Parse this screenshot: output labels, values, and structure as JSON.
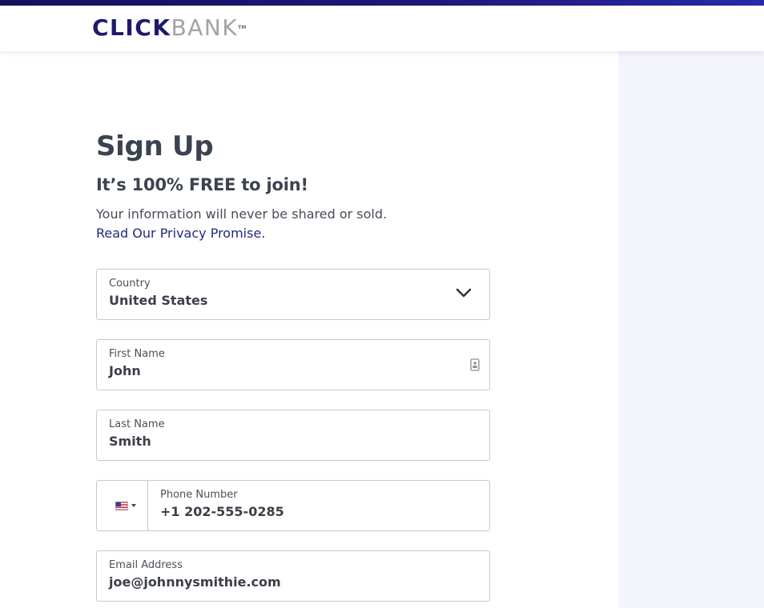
{
  "header": {
    "logo_click": "CLICK",
    "logo_bank": "BANK",
    "logo_tm": "TM"
  },
  "signup": {
    "title": "Sign Up",
    "subtitle": "It’s 100% FREE to join!",
    "info": "Your information will never be shared or sold.",
    "privacy_link": "Read Our Privacy Promise."
  },
  "form": {
    "country": {
      "label": "Country",
      "value": "United States"
    },
    "first_name": {
      "label": "First Name",
      "value": "John"
    },
    "last_name": {
      "label": "Last Name",
      "value": "Smith"
    },
    "phone": {
      "label": "Phone Number",
      "value": "+1 202-555-0285",
      "flag": "us-flag-icon"
    },
    "email": {
      "label": "Email Address",
      "value": "joe@johnnysmithie.com"
    }
  },
  "colors": {
    "brand_navy": "#1e1b6b",
    "brand_gray": "#a2a2a8",
    "side_panel": "#f4f4fd",
    "link": "#1e2b7a"
  }
}
